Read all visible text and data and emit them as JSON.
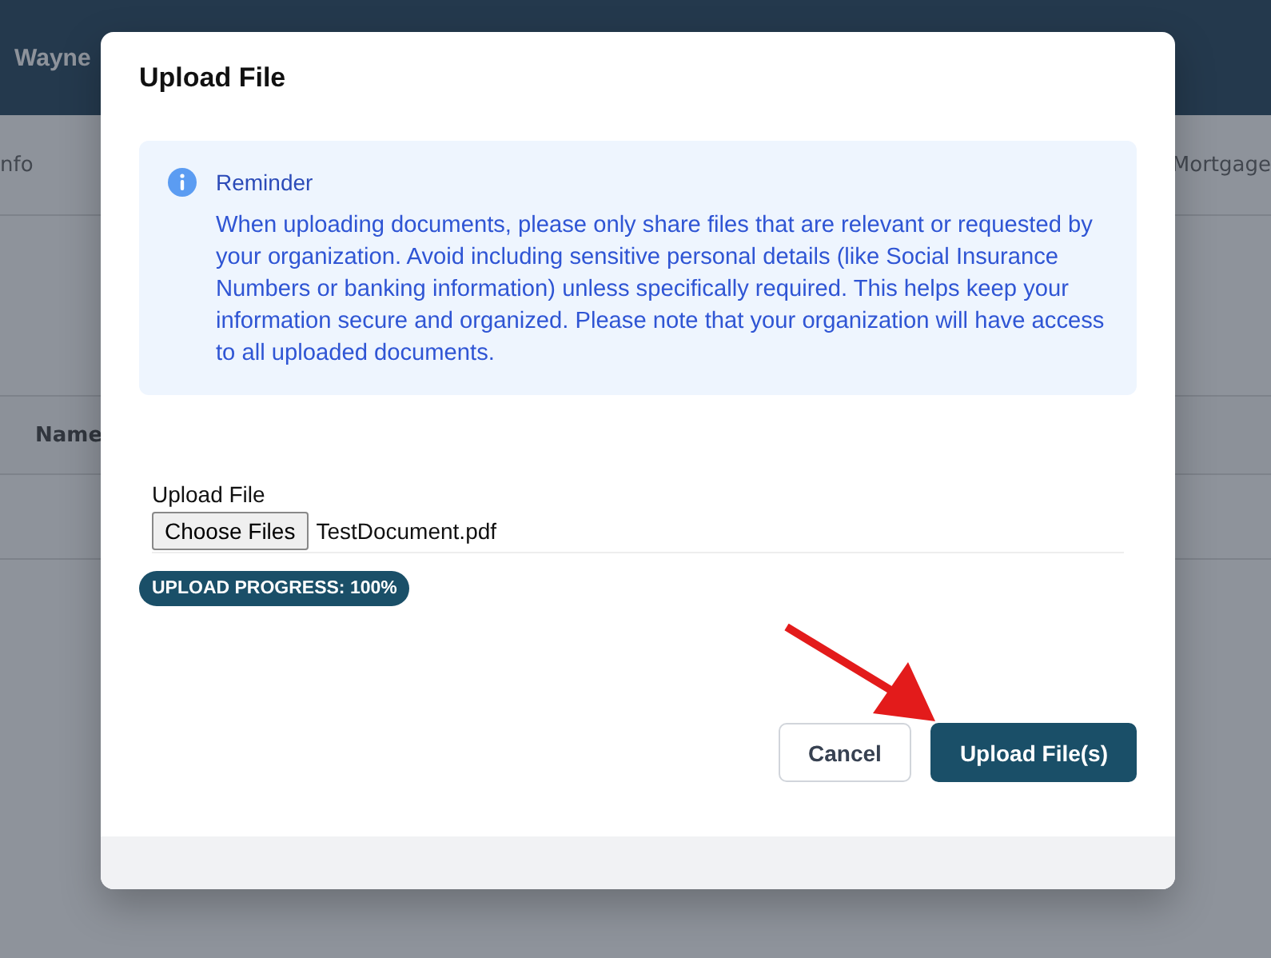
{
  "background": {
    "title": "Wayne",
    "tabs": [
      {
        "label": "nfo",
        "selected": false
      },
      {
        "label": "Mortgage",
        "selected": false
      }
    ],
    "table": {
      "columns": [
        "Name"
      ]
    }
  },
  "dialog": {
    "title": "Upload File",
    "reminder": {
      "title": "Reminder",
      "text": "When uploading documents, please only share files that are relevant or requested by your organization. Avoid including sensitive personal details (like Social Insurance Numbers or banking information) unless specifically required. This helps keep your information secure and organized. Please note that your organization will have access to all uploaded documents."
    },
    "upload": {
      "label": "Upload File",
      "button": "Choose Files",
      "value": "TestDocument.pdf"
    },
    "progress": {
      "text": "UPLOAD PROGRESS: 100%"
    },
    "buttons": [
      {
        "label": "Cancel",
        "kind": "secondary"
      },
      {
        "label": "Upload File(s)",
        "kind": "primary"
      }
    ]
  }
}
